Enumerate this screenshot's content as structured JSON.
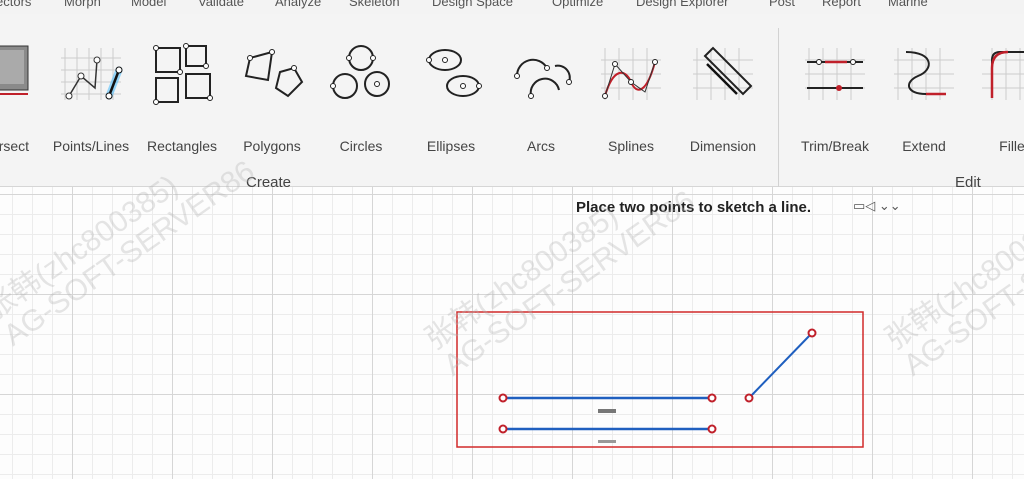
{
  "menu": [
    "ectors",
    "Morph",
    "Model",
    "Validate",
    "Analyze",
    "Skeleton",
    "Design Space",
    "Optimize",
    "Design Explorer",
    "Post",
    "Report",
    "Marine"
  ],
  "ribbon": {
    "create_tools": [
      {
        "id": "intersect",
        "label": "ersect",
        "icon": "intersect-icon"
      },
      {
        "id": "points-lines",
        "label": "Points/Lines",
        "icon": "points-lines-icon"
      },
      {
        "id": "rectangles",
        "label": "Rectangles",
        "icon": "rectangles-icon"
      },
      {
        "id": "polygons",
        "label": "Polygons",
        "icon": "polygons-icon"
      },
      {
        "id": "circles",
        "label": "Circles",
        "icon": "circles-icon"
      },
      {
        "id": "ellipses",
        "label": "Ellipses",
        "icon": "ellipses-icon"
      },
      {
        "id": "arcs",
        "label": "Arcs",
        "icon": "arcs-icon"
      },
      {
        "id": "splines",
        "label": "Splines",
        "icon": "splines-icon"
      },
      {
        "id": "dimension",
        "label": "Dimension",
        "icon": "dimension-icon"
      }
    ],
    "edit_tools": [
      {
        "id": "trim-break",
        "label": "Trim/Break",
        "icon": "trim-break-icon"
      },
      {
        "id": "extend",
        "label": "Extend",
        "icon": "extend-icon"
      },
      {
        "id": "fillet",
        "label": "Fille",
        "icon": "fillet-icon"
      }
    ],
    "create_group_label": "Create",
    "edit_group_label": "Edit"
  },
  "prompt": {
    "text": "Place two points to sketch a line.",
    "icons": "▭◁ ⌄⌄"
  },
  "watermark": [
    "张韩(zhc800385)",
    "AG-SOFT-SERVER86"
  ],
  "colors": {
    "line": "#1f5fbf",
    "point": "#c0202a",
    "selection": "#d22a2a",
    "active_icon_glow": "#39b7ff"
  }
}
